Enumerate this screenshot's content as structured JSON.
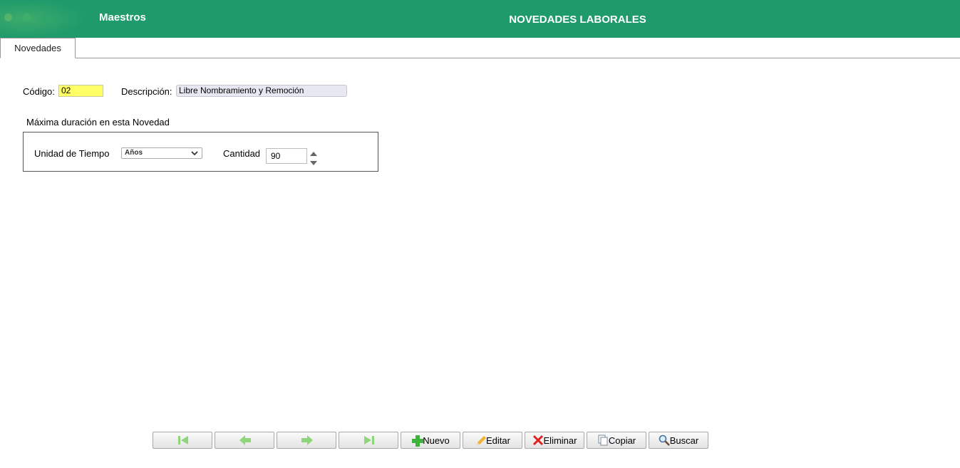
{
  "header": {
    "brand": "Maestros",
    "title": "NOVEDADES LABORALES",
    "accent_color": "#1f9b6b"
  },
  "tabs": [
    {
      "label": "Novedades",
      "active": true
    }
  ],
  "form": {
    "codigo_label": "Código:",
    "codigo_value": "02",
    "descripcion_label": "Descripción:",
    "descripcion_value": "Libre Nombramiento y Remoción",
    "section_title": "Máxima duración en esta Novedad",
    "unidad_label": "Unidad de Tiempo",
    "unidad_value": "Años",
    "cantidad_label": "Cantidad",
    "cantidad_value": "90"
  },
  "toolbar": {
    "nav_buttons": [
      {
        "name": "first-record",
        "icon": "first-icon"
      },
      {
        "name": "previous-record",
        "icon": "arrow-left-icon"
      },
      {
        "name": "next-record",
        "icon": "arrow-right-icon"
      },
      {
        "name": "last-record",
        "icon": "last-icon"
      }
    ],
    "nuevo_label": "Nuevo",
    "editar_label": "Editar",
    "eliminar_label": "Eliminar",
    "copiar_label": "Copiar",
    "buscar_label": "Buscar"
  }
}
